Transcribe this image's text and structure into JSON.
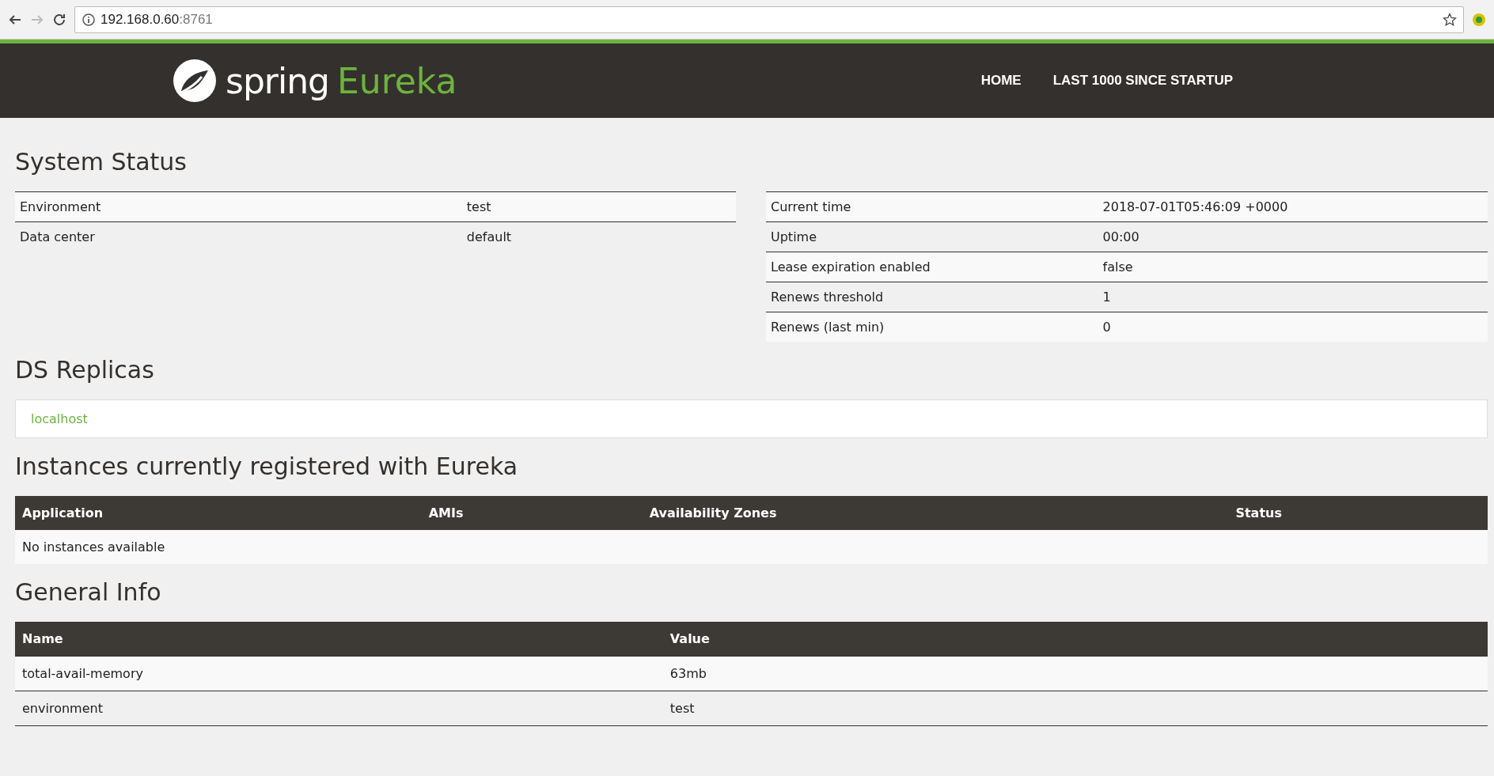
{
  "browser": {
    "url_host": "192.168.0.60",
    "url_port": ":8761"
  },
  "navbar": {
    "brand_word": "spring",
    "brand_product": "Eureka",
    "links": [
      "HOME",
      "LAST 1000 SINCE STARTUP"
    ]
  },
  "system_status": {
    "title": "System Status",
    "left_table": [
      {
        "name": "Environment",
        "value": "test"
      },
      {
        "name": "Data center",
        "value": "default"
      }
    ],
    "right_table": [
      {
        "name": "Current time",
        "value": "2018-07-01T05:46:09 +0000"
      },
      {
        "name": "Uptime",
        "value": "00:00"
      },
      {
        "name": "Lease expiration enabled",
        "value": "false"
      },
      {
        "name": "Renews threshold",
        "value": "1"
      },
      {
        "name": "Renews (last min)",
        "value": "0"
      }
    ]
  },
  "ds_replicas": {
    "title": "DS Replicas",
    "items": [
      "localhost"
    ]
  },
  "instances": {
    "title": "Instances currently registered with Eureka",
    "columns": [
      "Application",
      "AMIs",
      "Availability Zones",
      "Status"
    ],
    "empty_message": "No instances available"
  },
  "general_info": {
    "title": "General Info",
    "columns": [
      "Name",
      "Value"
    ],
    "rows": [
      {
        "name": "total-avail-memory",
        "value": "63mb"
      },
      {
        "name": "environment",
        "value": "test"
      }
    ]
  }
}
